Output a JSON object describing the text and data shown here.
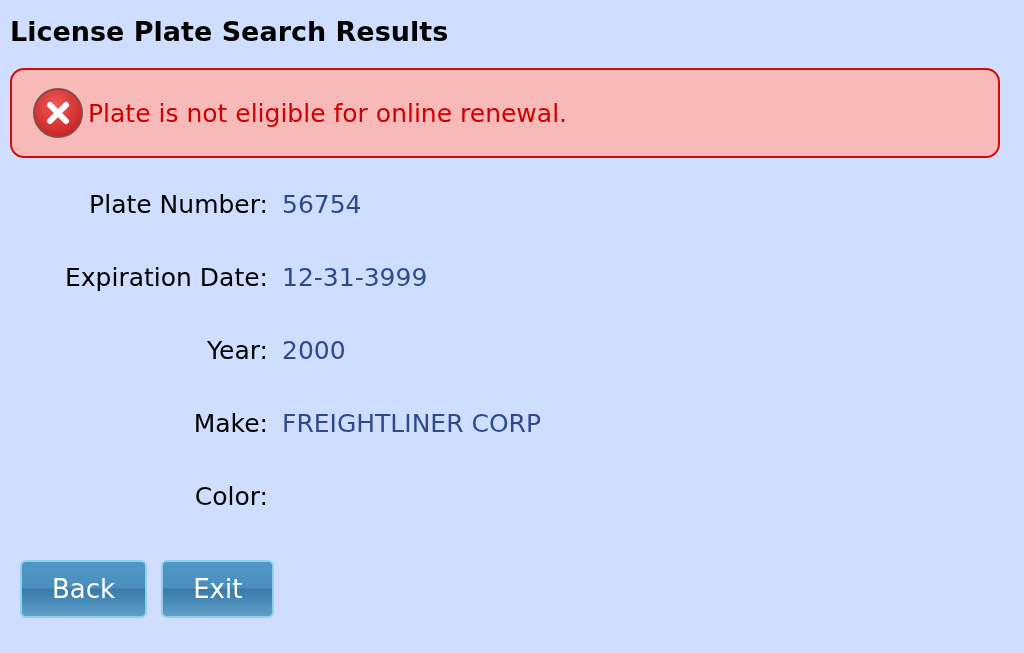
{
  "title": "License Plate Search Results",
  "alert": {
    "kind": "error",
    "message": "Plate is not eligible for online renewal."
  },
  "fields": [
    {
      "label": "Plate Number:",
      "value": "56754"
    },
    {
      "label": "Expiration Date:",
      "value": "12-31-3999"
    },
    {
      "label": "Year:",
      "value": "2000"
    },
    {
      "label": "Make:",
      "value": "FREIGHTLINER CORP"
    },
    {
      "label": "Color:"
    }
  ],
  "buttons": [
    "Back",
    "Exit"
  ]
}
